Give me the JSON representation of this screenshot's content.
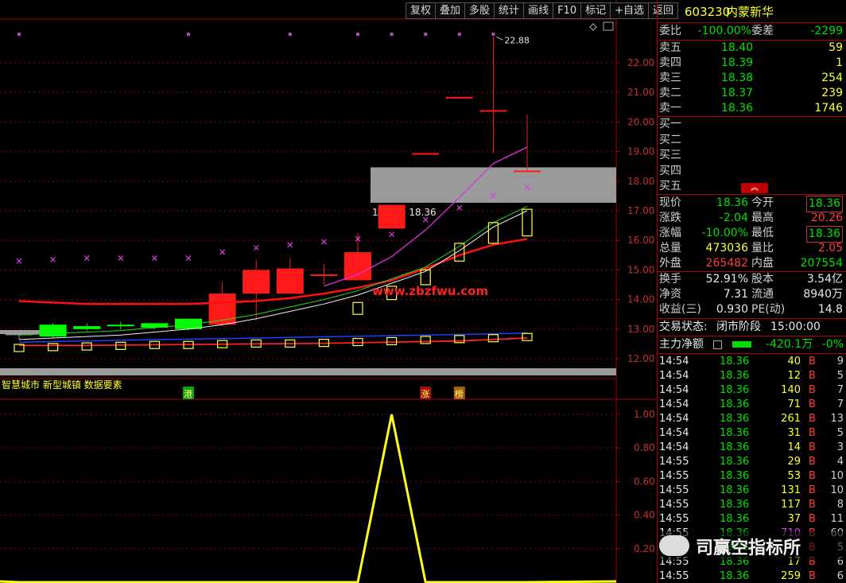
{
  "toolbar": [
    "复权",
    "叠加",
    "多股",
    "统计",
    "画线",
    "F10",
    "标记",
    "+自选",
    "返回"
  ],
  "stock": {
    "code": "603230",
    "name": "内蒙新华"
  },
  "order_book": {
    "ratio_label": "委比",
    "ratio_value": "-100.00%",
    "diff_label": "委差",
    "diff_value": "-2299",
    "asks": [
      {
        "label": "卖五",
        "price": "18.40",
        "vol": "59"
      },
      {
        "label": "卖四",
        "price": "18.39",
        "vol": "1"
      },
      {
        "label": "卖三",
        "price": "18.38",
        "vol": "254"
      },
      {
        "label": "卖二",
        "price": "18.37",
        "vol": "239"
      },
      {
        "label": "卖一",
        "price": "18.36",
        "vol": "1746"
      }
    ],
    "bids": [
      "买一",
      "买二",
      "买三",
      "买四",
      "买五"
    ]
  },
  "quote": {
    "rows": [
      {
        "l1": "现价",
        "v1": "18.36",
        "c1": "green",
        "l2": "今开",
        "v2": "18.36",
        "c2": "green",
        "b2": true
      },
      {
        "l1": "涨跌",
        "v1": "-2.04",
        "c1": "green",
        "l2": "最高",
        "v2": "20.26",
        "c2": "red"
      },
      {
        "l1": "涨幅",
        "v1": "-10.00%",
        "c1": "green",
        "l2": "最低",
        "v2": "18.36",
        "c2": "green",
        "b2": true
      },
      {
        "l1": "总量",
        "v1": "473036",
        "c1": "yellow",
        "l2": "量比",
        "v2": "2.05",
        "c2": "red"
      },
      {
        "l1": "外盘",
        "v1": "265482",
        "c1": "red",
        "l2": "内盘",
        "v2": "207554",
        "c2": "green"
      }
    ],
    "rows2": [
      {
        "l1": "换手",
        "v1": "52.91%",
        "l2": "股本",
        "v2": "3.54亿"
      },
      {
        "l1": "净资",
        "v1": "7.31",
        "l2": "流通",
        "v2": "8940万"
      },
      {
        "l1": "收益(三)",
        "v1": "0.930",
        "l2": "PE(动)",
        "v2": "14.8"
      }
    ]
  },
  "status": {
    "label": "交易状态:",
    "value": "闭市阶段",
    "time": "15:00:00"
  },
  "main_force": {
    "label": "主力净额",
    "value": "-420.1万",
    "pct": "-0%"
  },
  "ticks": [
    {
      "t": "14:54",
      "p": "18.36",
      "v": "40",
      "bs": "B",
      "n": "9"
    },
    {
      "t": "14:54",
      "p": "18.36",
      "v": "12",
      "bs": "B",
      "n": "5"
    },
    {
      "t": "14:54",
      "p": "18.36",
      "v": "140",
      "bs": "B",
      "n": "7"
    },
    {
      "t": "14:54",
      "p": "18.36",
      "v": "71",
      "bs": "B",
      "n": "7"
    },
    {
      "t": "14:54",
      "p": "18.36",
      "v": "261",
      "bs": "B",
      "n": "13"
    },
    {
      "t": "14:54",
      "p": "18.36",
      "v": "31",
      "bs": "B",
      "n": "5"
    },
    {
      "t": "14:54",
      "p": "18.36",
      "v": "14",
      "bs": "B",
      "n": "3"
    },
    {
      "t": "14:55",
      "p": "18.36",
      "v": "29",
      "bs": "B",
      "n": "4"
    },
    {
      "t": "14:55",
      "p": "18.36",
      "v": "53",
      "bs": "B",
      "n": "10"
    },
    {
      "t": "14:55",
      "p": "18.36",
      "v": "131",
      "bs": "B",
      "n": "10"
    },
    {
      "t": "14:55",
      "p": "18.36",
      "v": "117",
      "bs": "B",
      "n": "8"
    },
    {
      "t": "14:55",
      "p": "18.36",
      "v": "37",
      "bs": "B",
      "n": "11"
    },
    {
      "t": "14:55",
      "p": "18.36",
      "v": "710",
      "bs": "B",
      "n": "60",
      "vc": "magenta"
    },
    {
      "t": "14:55",
      "p": "18.36",
      "v": "",
      "bs": "B",
      "n": "5"
    },
    {
      "t": "14:55",
      "p": "18.36",
      "v": "17",
      "bs": "B",
      "n": "6"
    },
    {
      "t": "14:55",
      "p": "18.36",
      "v": "259",
      "bs": "B",
      "n": "6"
    }
  ],
  "watermark": "司赢空指标所",
  "site_watermark": "www.zbzfwu.com",
  "concepts": "智慧城市 新型城镇 数据要素",
  "markers": [
    "港",
    "涨",
    "榜"
  ],
  "annotations": {
    "high": "22.88",
    "range": "17.19 - 18.36"
  },
  "colors": {
    "up": "#ff2020",
    "down": "#00ff00",
    "bg": "#000000",
    "grid": "#8b0000"
  },
  "chart_data": [
    {
      "type": "candlestick",
      "ylim": [
        11.5,
        23.5
      ],
      "yticks": [
        "22.00",
        "21.00",
        "20.00",
        "19.00",
        "18.00",
        "17.00",
        "16.00",
        "15.00",
        "14.00",
        "13.00",
        "12.00"
      ],
      "candles": [
        {
          "o": 12.85,
          "h": 12.95,
          "l": 12.65,
          "c": 12.8,
          "col": "gray"
        },
        {
          "o": 12.75,
          "h": 13.2,
          "l": 12.7,
          "c": 13.15,
          "col": "green"
        },
        {
          "o": 13.1,
          "h": 13.2,
          "l": 12.95,
          "c": 13.0,
          "col": "green"
        },
        {
          "o": 13.1,
          "h": 13.25,
          "l": 13.0,
          "c": 13.15,
          "col": "green"
        },
        {
          "o": 13.05,
          "h": 13.2,
          "l": 13.0,
          "c": 13.2,
          "col": "green"
        },
        {
          "o": 13.0,
          "h": 13.35,
          "l": 12.95,
          "c": 13.35,
          "col": "green"
        },
        {
          "o": 13.15,
          "h": 14.6,
          "l": 13.1,
          "c": 14.2,
          "col": "red"
        },
        {
          "o": 14.2,
          "h": 15.35,
          "l": 13.3,
          "c": 15.0,
          "col": "red"
        },
        {
          "o": 14.2,
          "h": 15.4,
          "l": 14.2,
          "c": 15.05,
          "col": "red"
        },
        {
          "o": 14.85,
          "h": 15.2,
          "l": 14.5,
          "c": 14.85,
          "col": "red"
        },
        {
          "o": 14.65,
          "h": 16.25,
          "l": 14.65,
          "c": 15.6,
          "col": "red"
        },
        {
          "o": 16.4,
          "h": 17.2,
          "l": 16.4,
          "c": 17.2,
          "col": "red"
        },
        {
          "o": 18.95,
          "h": 18.95,
          "l": 18.95,
          "c": 18.95,
          "col": "red"
        },
        {
          "o": 20.85,
          "h": 20.85,
          "l": 20.85,
          "c": 20.85,
          "col": "red"
        },
        {
          "o": 20.4,
          "h": 22.88,
          "l": 18.95,
          "c": 20.35,
          "col": "red"
        },
        {
          "o": 18.36,
          "h": 20.26,
          "l": 18.36,
          "c": 18.36,
          "col": "red"
        }
      ],
      "ma_magenta": [
        null,
        null,
        null,
        null,
        null,
        null,
        null,
        null,
        null,
        14.45,
        14.85,
        15.45,
        16.35,
        17.45,
        18.6,
        19.15
      ],
      "ma_green": [
        12.8,
        12.85,
        12.9,
        12.95,
        13.05,
        13.15,
        13.3,
        13.5,
        13.75,
        14.0,
        14.3,
        14.7,
        15.1,
        15.8,
        16.6,
        17.15
      ],
      "ma_red": [
        13.95,
        13.9,
        13.85,
        13.85,
        13.85,
        13.85,
        13.9,
        13.95,
        14.05,
        14.2,
        14.4,
        14.65,
        15.05,
        15.5,
        15.85,
        16.05
      ],
      "ma_blue": [
        12.55,
        12.58,
        12.6,
        12.62,
        12.65,
        12.66,
        12.68,
        12.7,
        12.72,
        12.74,
        12.76,
        12.78,
        12.8,
        12.82,
        12.84,
        12.87
      ],
      "ma_red_low": [
        12.45,
        12.45,
        12.45,
        12.46,
        12.47,
        12.48,
        12.49,
        12.5,
        12.51,
        12.52,
        12.54,
        12.56,
        12.58,
        12.6,
        12.65,
        12.7
      ],
      "boxes": [
        12.35,
        12.38,
        12.4,
        12.42,
        12.45,
        12.45,
        12.48,
        12.5,
        12.5,
        12.52,
        12.55,
        12.58,
        12.62,
        12.65,
        12.68,
        12.72
      ],
      "rising_boxes": [
        [
          10,
          13.5,
          13.9
        ],
        [
          11,
          14.0,
          14.45
        ],
        [
          12,
          14.5,
          15.0
        ],
        [
          13,
          15.3,
          15.9
        ],
        [
          14,
          15.9,
          16.6
        ],
        [
          15,
          16.15,
          17.05
        ]
      ],
      "crosses_low": [
        15.3,
        15.35,
        15.4,
        15.4,
        15.4,
        15.4,
        15.6,
        15.75,
        15.85,
        15.95,
        16.05,
        16.2,
        16.7,
        17.1,
        17.5,
        17.8
      ],
      "dots_top": [
        22.95,
        null,
        null,
        null,
        null,
        22.95,
        null,
        null,
        22.95,
        null,
        22.95,
        22.95,
        22.95,
        22.95,
        22.95,
        null
      ]
    },
    {
      "type": "line",
      "ylim": [
        0,
        1.05
      ],
      "yticks": [
        "1.00",
        "0.80",
        "0.60",
        "0.40",
        "0.20"
      ],
      "values": [
        0,
        0,
        0,
        0,
        0,
        0,
        0,
        0,
        0,
        0,
        0,
        1,
        0,
        0,
        0,
        0
      ]
    }
  ]
}
